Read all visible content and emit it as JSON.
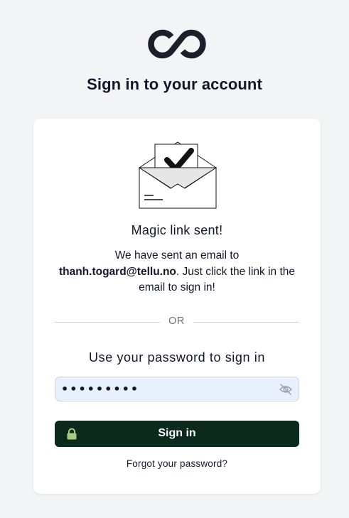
{
  "header": {
    "logo_icon": "infinity-logo-icon",
    "title": "Sign in to your account"
  },
  "card": {
    "illustration_icon": "envelope-check-icon",
    "heading": "Magic link sent!",
    "message": {
      "line_prefix": "We have sent an email to",
      "email": "thanh.togard@tellu.no",
      "line_suffix": ". Just click the link in the email to sign in!"
    },
    "divider_text": "OR",
    "password_heading": "Use your password to sign in",
    "password_field": {
      "value": "•••••••••",
      "toggle_icon": "eye-off-icon"
    },
    "signin_button": {
      "label": "Sign in",
      "icon": "lock-icon"
    },
    "forgot_link": "Forgot your password?"
  },
  "colors": {
    "page_background": "#f2f4f6",
    "button_background": "#0b2a1b",
    "lock_icon": "#a8c97f",
    "input_background": "#e8f0fe"
  }
}
